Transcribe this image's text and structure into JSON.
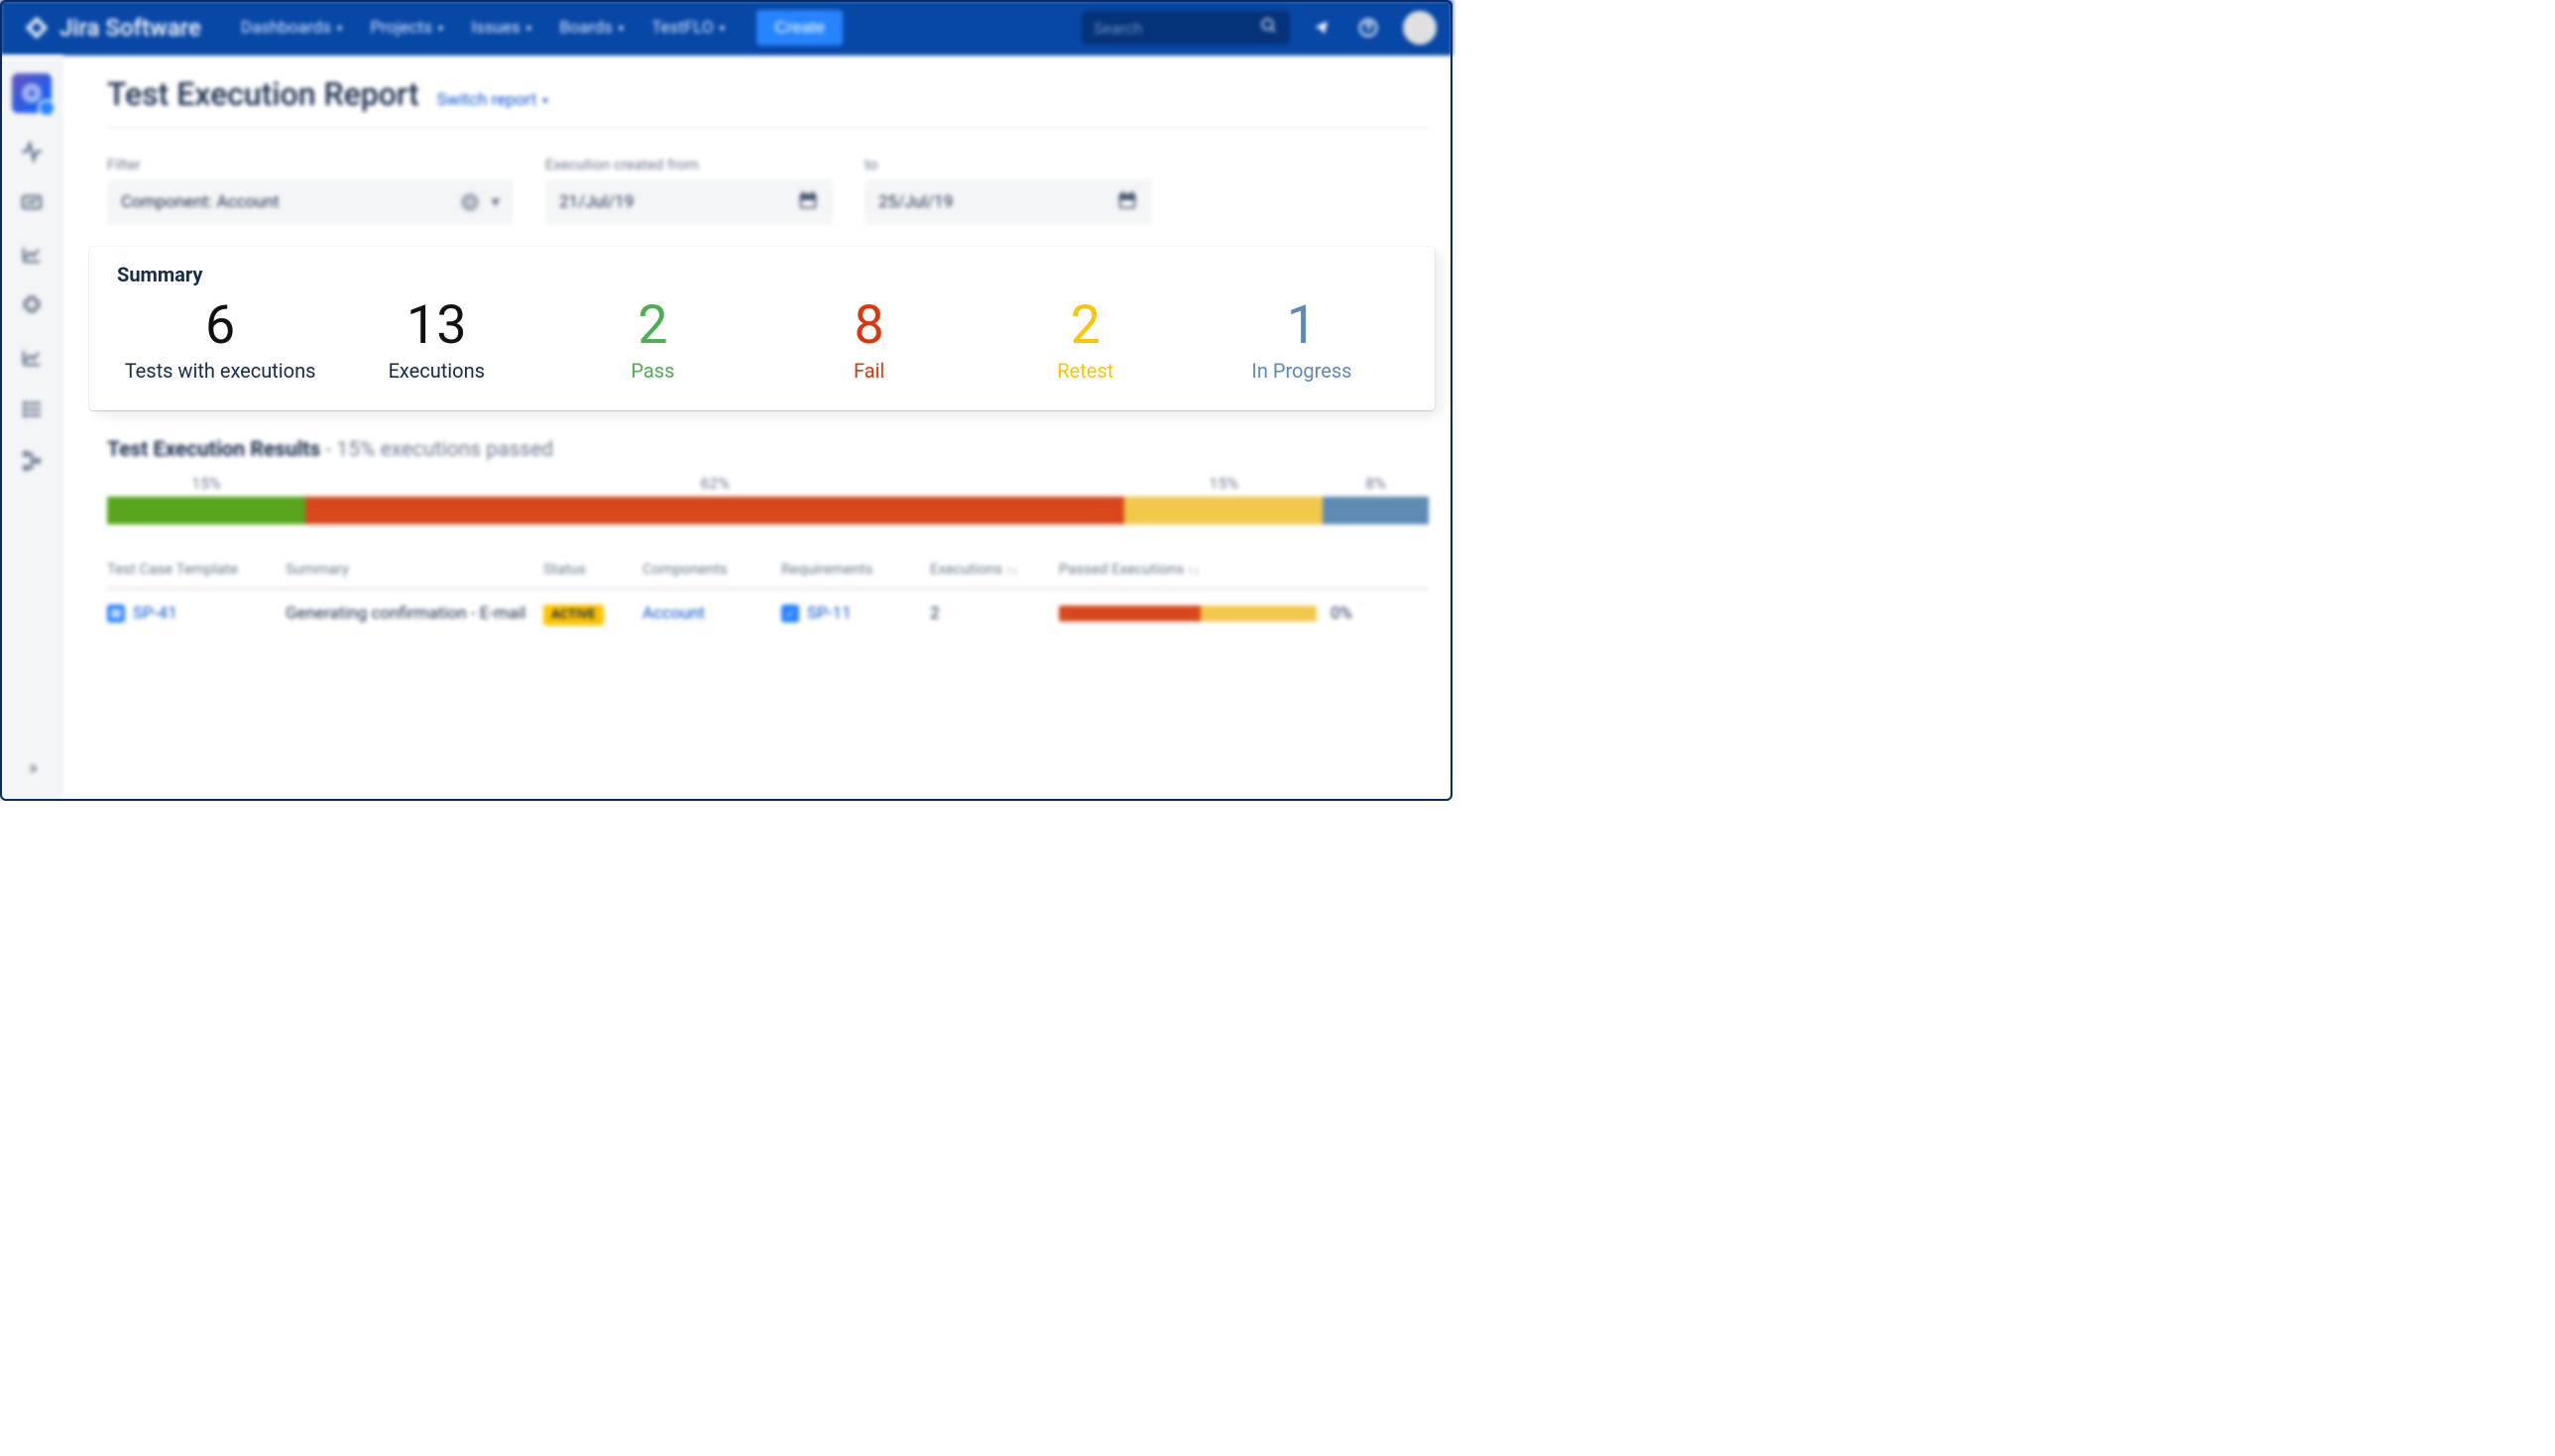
{
  "colors": {
    "green": "#57A61D",
    "red": "#D8481C",
    "amber": "#F2C84B",
    "blue": "#5E8AB4"
  },
  "topnav": {
    "product": "Jira Software",
    "items": [
      "Dashboards",
      "Projects",
      "Issues",
      "Boards",
      "TestFLO"
    ],
    "create": "Create",
    "search_placeholder": "Search"
  },
  "page": {
    "title": "Test Execution Report",
    "switch_label": "Switch report"
  },
  "filters": {
    "filter_label": "Filter",
    "filter_value": "Component: Account",
    "from_label": "Execution created from",
    "from_value": "21/Jul/19",
    "to_label": "to",
    "to_value": "25/Jul/19"
  },
  "summary": {
    "title": "Summary",
    "stats": [
      {
        "value": "6",
        "label": "Tests with executions",
        "tone": "black"
      },
      {
        "value": "13",
        "label": "Executions",
        "tone": "black"
      },
      {
        "value": "2",
        "label": "Pass",
        "tone": "green"
      },
      {
        "value": "8",
        "label": "Fail",
        "tone": "red"
      },
      {
        "value": "2",
        "label": "Retest",
        "tone": "amber"
      },
      {
        "value": "1",
        "label": "In Progress",
        "tone": "blue"
      }
    ]
  },
  "results": {
    "heading_bold": "Test Execution Results",
    "heading_sub": " - 15% executions passed",
    "segments": [
      {
        "label": "15%",
        "pct": 15,
        "color": "green"
      },
      {
        "label": "62%",
        "pct": 62,
        "color": "red"
      },
      {
        "label": "15%",
        "pct": 15,
        "color": "amber"
      },
      {
        "label": "8%",
        "pct": 8,
        "color": "blue"
      }
    ]
  },
  "table": {
    "columns": {
      "tc": "Test Case Template",
      "sum": "Summary",
      "st": "Status",
      "cmp": "Components",
      "req": "Requirements",
      "ex": "Executions",
      "pe": "Passed Executions"
    },
    "rows": [
      {
        "tc_key": "SP-41",
        "summary": "Generating confirmation - E-mail",
        "status": "ACTIVE",
        "component": "Account",
        "requirement": "SP-11",
        "executions": "2",
        "passed_pct_label": "0%",
        "mini": [
          {
            "pct": 55,
            "color": "red"
          },
          {
            "pct": 45,
            "color": "amber"
          }
        ]
      }
    ]
  }
}
